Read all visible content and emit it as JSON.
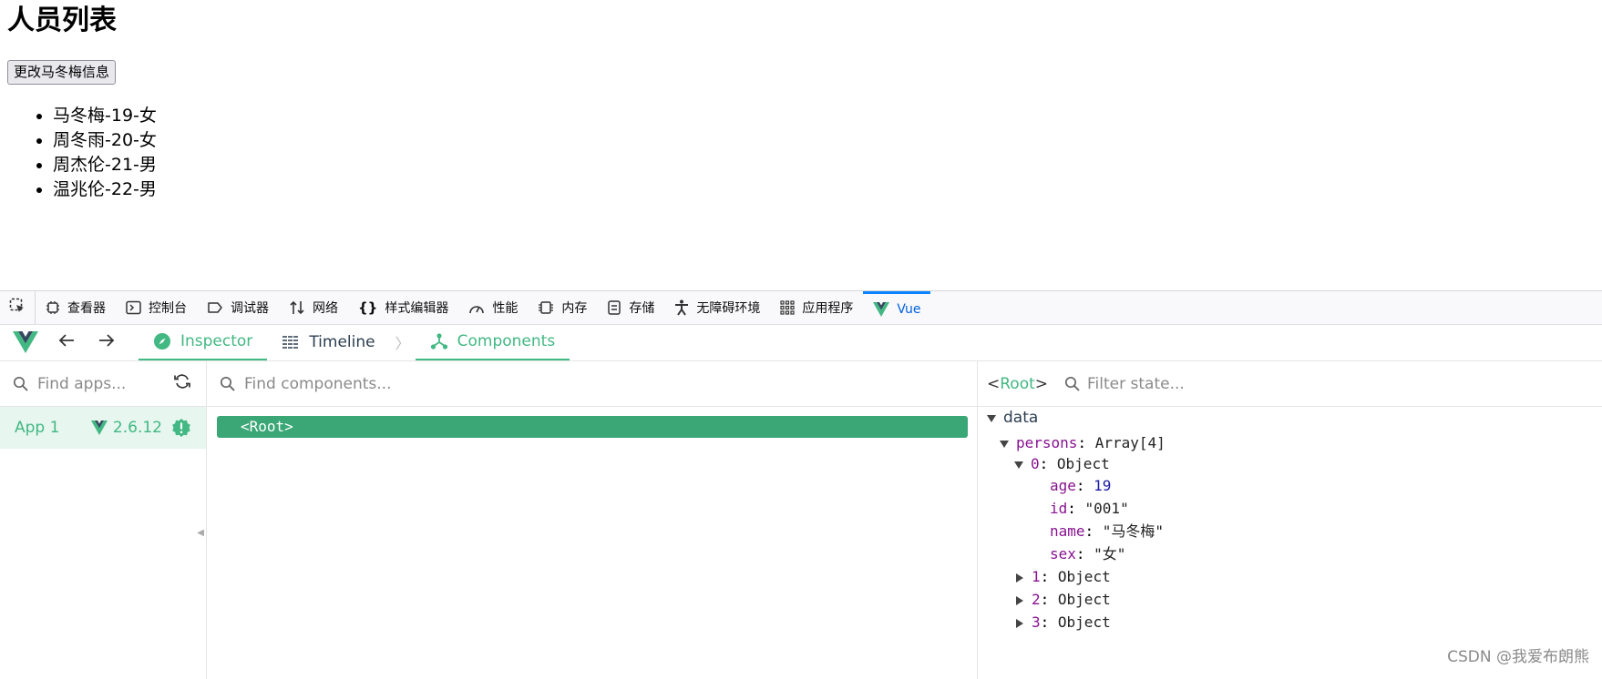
{
  "page": {
    "title": "人员列表",
    "button_label": "更改马冬梅信息",
    "persons": [
      "马冬梅-19-女",
      "周冬雨-20-女",
      "周杰伦-21-男",
      "温兆伦-22-男"
    ]
  },
  "devtools": {
    "tabs": [
      {
        "label": "查看器",
        "icon": "inspector-icon"
      },
      {
        "label": "控制台",
        "icon": "console-icon"
      },
      {
        "label": "调试器",
        "icon": "debugger-icon"
      },
      {
        "label": "网络",
        "icon": "network-icon"
      },
      {
        "label": "样式编辑器",
        "icon": "style-editor-icon"
      },
      {
        "label": "性能",
        "icon": "performance-icon"
      },
      {
        "label": "内存",
        "icon": "memory-icon"
      },
      {
        "label": "存储",
        "icon": "storage-icon"
      },
      {
        "label": "无障碍环境",
        "icon": "accessibility-icon"
      },
      {
        "label": "应用程序",
        "icon": "application-icon"
      },
      {
        "label": "Vue",
        "icon": "vue-logo-icon"
      }
    ],
    "active_tab": "Vue",
    "accent_color": "#0a84ff"
  },
  "vue": {
    "tabs": {
      "inspector": "Inspector",
      "timeline": "Timeline",
      "components": "Components"
    },
    "find_apps_placeholder": "Find apps...",
    "find_components_placeholder": "Find components...",
    "filter_state_placeholder": "Filter state...",
    "app_name": "App 1",
    "vue_version": "2.6.12",
    "root_component": "<Root>",
    "state_root_prefix": "<",
    "state_root_name": "Root",
    "state_root_suffix": ">",
    "accent_color": "#42b883"
  },
  "state": {
    "section": "data",
    "persons_key": "persons",
    "persons_type": "Array[4]",
    "item0_key": "0",
    "item0_type": "Object",
    "fields": [
      {
        "key": "age",
        "value": "19"
      },
      {
        "key": "id",
        "value": "\"001\""
      },
      {
        "key": "name",
        "value": "\"马冬梅\""
      },
      {
        "key": "sex",
        "value": "\"女\""
      }
    ],
    "collapsed_items": [
      {
        "key": "1",
        "type": "Object"
      },
      {
        "key": "2",
        "type": "Object"
      },
      {
        "key": "3",
        "type": "Object"
      }
    ]
  },
  "watermark": "CSDN @我爱布朗熊"
}
